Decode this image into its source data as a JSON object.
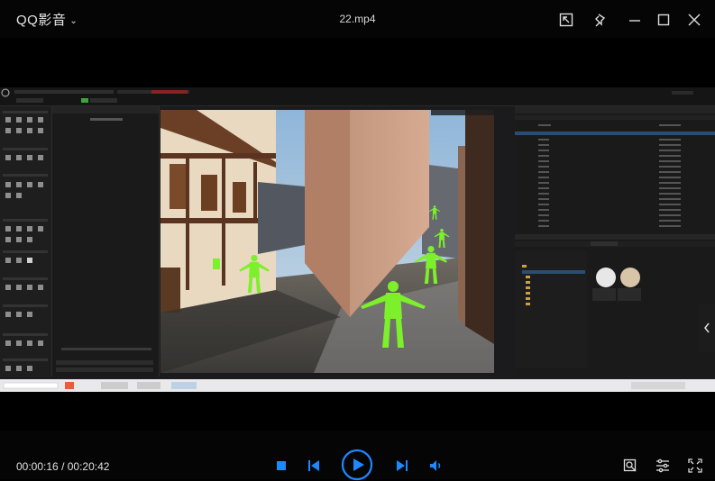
{
  "player": {
    "app_name": "QQ影音",
    "file_name": "22.mp4",
    "time_current": "00:00:16",
    "time_total": "00:20:42",
    "progress_fraction": 0.013
  },
  "colors": {
    "accent": "#1e88ff",
    "character_green": "#7cf02a"
  },
  "icons": {
    "app_menu": "chevron-down-icon",
    "screenshot": "screenshot-icon",
    "pin": "pin-icon",
    "minimize": "minimize-icon",
    "maximize": "maximize-icon",
    "close": "close-icon",
    "stop": "stop-icon",
    "prev": "previous-icon",
    "play": "play-icon",
    "next": "next-icon",
    "volume": "volume-icon",
    "search": "zoom-icon",
    "settings": "equalizer-icon",
    "fullscreen": "fullscreen-icon",
    "playlist_toggle": "chevron-left-icon"
  }
}
